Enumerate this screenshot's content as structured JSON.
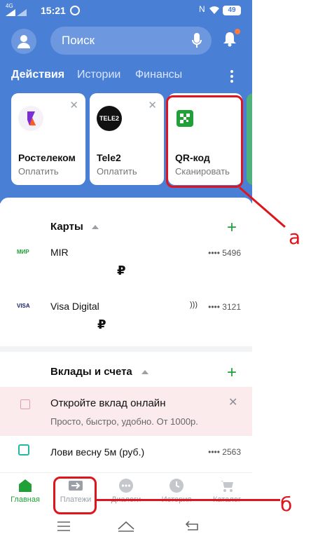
{
  "status_bar": {
    "network": "4G",
    "time": "15:21",
    "battery": "49",
    "nfc": "N"
  },
  "header": {
    "search_placeholder": "Поиск",
    "tabs": [
      "Действия",
      "Истории",
      "Финансы"
    ]
  },
  "action_cards": [
    {
      "name": "Ростелеком",
      "action": "Оплатить",
      "logo_text": ""
    },
    {
      "name": "Tele2",
      "action": "Оплатить",
      "logo_text": "TELE2"
    },
    {
      "name": "QR-код",
      "action": "Сканировать",
      "logo_text": ""
    }
  ],
  "cards_section": {
    "title": "Карты",
    "items": [
      {
        "logo": "МИР",
        "name": "MIR",
        "number": "•••• 5496",
        "balance": "₽"
      },
      {
        "logo": "VISA",
        "name": "Visa Digital",
        "number": "•••• 3121",
        "balance": "₽"
      }
    ]
  },
  "accounts_section": {
    "title": "Вклады и счета",
    "promo": {
      "title": "Откройте вклад онлайн",
      "subtitle": "Просто, быстро, удобно. От 1000р."
    },
    "items": [
      {
        "name": "Лови весну 5м (руб.)",
        "number": "•••• 2563"
      }
    ]
  },
  "bottom_nav": [
    {
      "label": "Главная",
      "active": true
    },
    {
      "label": "Платежи",
      "active": false
    },
    {
      "label": "Диалоги",
      "active": false
    },
    {
      "label": "История",
      "active": false
    },
    {
      "label": "Каталог",
      "active": false
    }
  ],
  "annotations": {
    "a": "а",
    "b": "б"
  },
  "colors": {
    "header_blue": "#4a7fd6",
    "accent_green": "#21a038",
    "annotation_red": "#e0141c"
  }
}
